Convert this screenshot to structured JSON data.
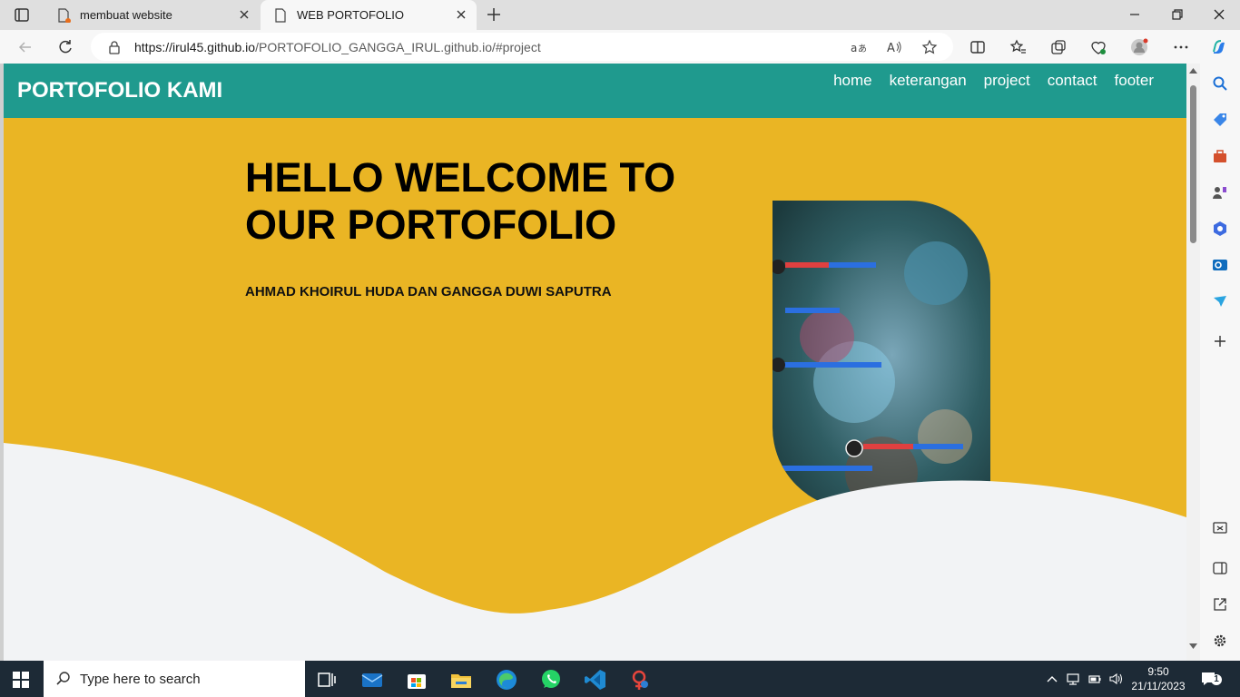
{
  "browser": {
    "tabs": [
      {
        "title": "membuat website",
        "active": false
      },
      {
        "title": "WEB PORTOFOLIO",
        "active": true
      }
    ],
    "url_host": "https://irul45.github.io",
    "url_path": "/PORTOFOLIO_GANGGA_IRUL.github.io/#project"
  },
  "site": {
    "brand": "PORTOFOLIO KAMI",
    "menu": [
      "home",
      "keterangan",
      "project",
      "contact",
      "footer"
    ],
    "hero_title": "HELLO WELCOME TO OUR PORTOFOLIO",
    "hero_subtitle": "AHMAD KHOIRUL HUDA DAN GANGGA DUWI SAPUTRA",
    "colors": {
      "nav": "#1f9a8e",
      "hero": "#eab524",
      "wave": "#f2f3f5"
    }
  },
  "taskbar": {
    "search_placeholder": "Type here to search",
    "time": "9:50",
    "date": "21/11/2023",
    "notification_count": "1"
  }
}
